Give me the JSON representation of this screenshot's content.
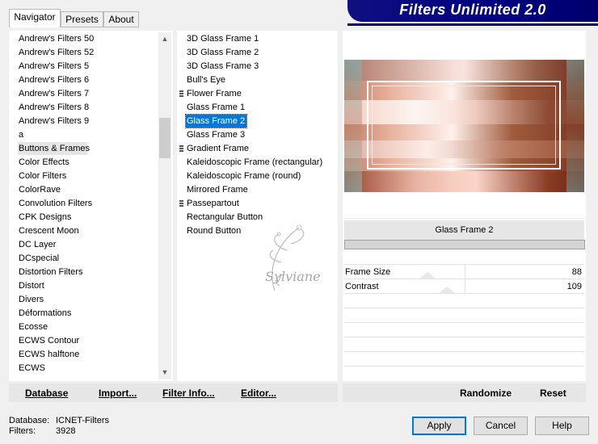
{
  "tabs": [
    {
      "label": "Navigator",
      "active": true
    },
    {
      "label": "Presets",
      "active": false
    },
    {
      "label": "About",
      "active": false
    }
  ],
  "banner": {
    "title": "Filters Unlimited 2.0"
  },
  "categories": [
    "Andrew's Filters 50",
    "Andrew's Filters 52",
    "Andrew's Filters 5",
    "Andrew's Filters 6",
    "Andrew's Filters 7",
    "Andrew's Filters 8",
    "Andrew's Filters 9",
    "a",
    "Buttons & Frames",
    "Color Effects",
    "Color Filters",
    "ColorRave",
    "Convolution Filters",
    "CPK Designs",
    "Crescent Moon",
    "DC Layer",
    "DCspecial",
    "Distortion Filters",
    "Distort",
    "Divers",
    "Déformations",
    "Ecosse",
    "ECWS Contour",
    "ECWS halftone",
    "ECWS"
  ],
  "selected_category": "Buttons & Frames",
  "filters": [
    {
      "label": "3D Glass Frame 1",
      "marker": false
    },
    {
      "label": "3D Glass Frame 2",
      "marker": false
    },
    {
      "label": "3D Glass Frame 3",
      "marker": false
    },
    {
      "label": "Bull's Eye",
      "marker": false
    },
    {
      "label": "Flower Frame",
      "marker": true
    },
    {
      "label": "Glass Frame 1",
      "marker": false
    },
    {
      "label": "Glass Frame 2",
      "marker": false
    },
    {
      "label": "Glass Frame 3",
      "marker": false
    },
    {
      "label": "Gradient Frame",
      "marker": true
    },
    {
      "label": "Kaleidoscopic Frame (rectangular)",
      "marker": false
    },
    {
      "label": "Kaleidoscopic Frame (round)",
      "marker": false
    },
    {
      "label": "Mirrored Frame",
      "marker": false
    },
    {
      "label": "Passepartout",
      "marker": true
    },
    {
      "label": "Rectangular Button",
      "marker": false
    },
    {
      "label": "Round Button",
      "marker": false
    }
  ],
  "selected_filter": "Glass Frame 2",
  "watermark": "Sylviane",
  "parameters": {
    "filter_name": "Glass Frame 2",
    "rows": [
      {
        "label": "Frame Size",
        "value": "88"
      },
      {
        "label": "Contrast",
        "value": "109"
      }
    ]
  },
  "toolbar": {
    "database": "Database",
    "import": "Import...",
    "filter_info": "Filter Info...",
    "editor": "Editor...",
    "randomize": "Randomize",
    "reset": "Reset"
  },
  "status": {
    "database_label": "Database:",
    "database_value": "ICNET-Filters",
    "filters_label": "Filters:",
    "filters_value": "3928"
  },
  "dialog_buttons": {
    "apply": "Apply",
    "cancel": "Cancel",
    "help": "Help"
  },
  "colors": {
    "banner_bg": "#000080",
    "selection": "#0078d7",
    "dialog_bg": "#f0f0f0"
  }
}
